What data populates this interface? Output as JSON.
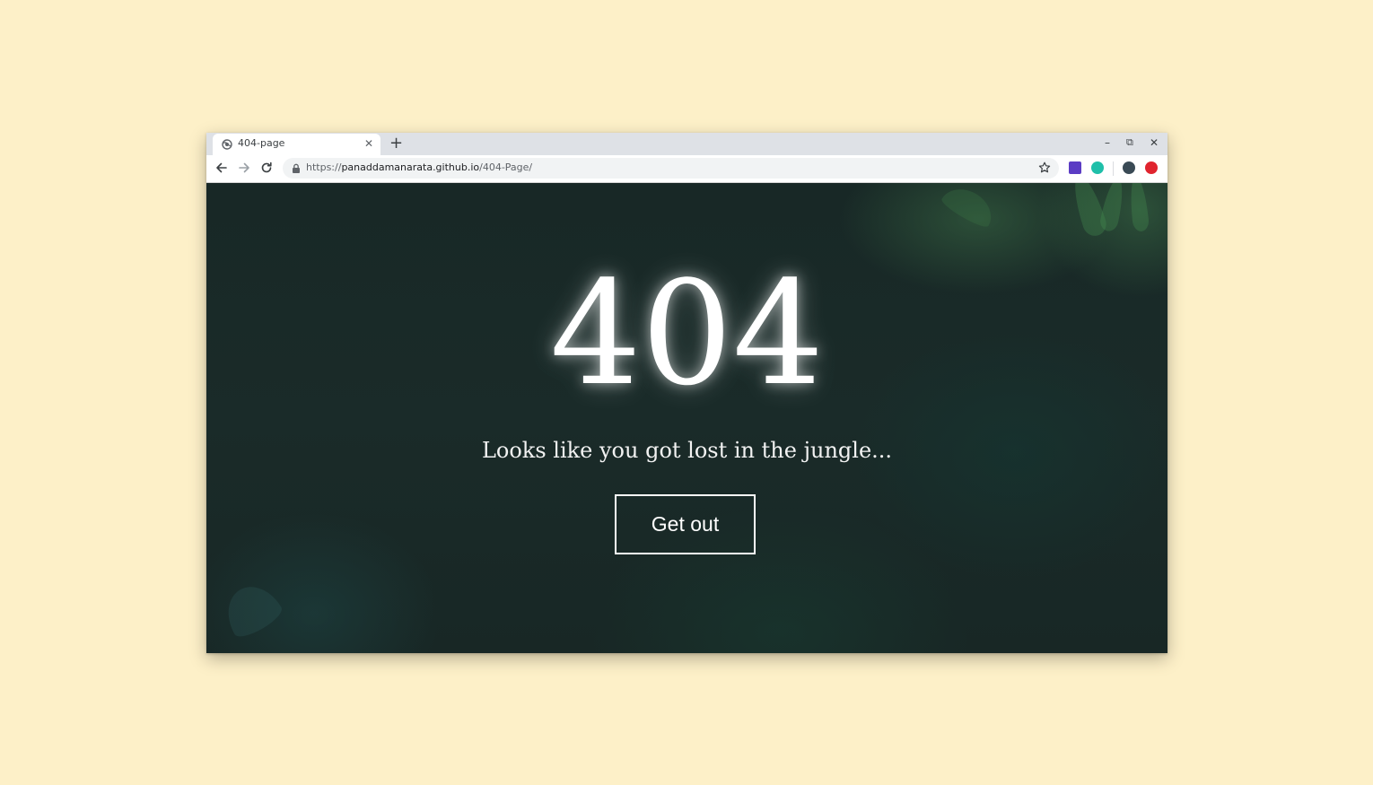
{
  "browser": {
    "tab": {
      "title": "404-page",
      "close_glyph": "✕"
    },
    "new_tab_glyph": "+",
    "window_controls": {
      "minimize": "–",
      "restore": "⧉",
      "close": "✕"
    },
    "address": {
      "scheme": "https://",
      "host": "panaddamanarata.github.io",
      "path": "/404-Page/"
    },
    "extensions": [
      {
        "name": "extension-purple-icon",
        "color": "#5b3cc4"
      },
      {
        "name": "extension-teal-icon",
        "color": "#1fbfa9"
      },
      {
        "name": "profile-avatar",
        "color": "#3a4a55"
      },
      {
        "name": "extension-red-icon",
        "color": "#e0242e"
      }
    ]
  },
  "page": {
    "heading": "404",
    "subtitle": "Looks like you got lost in the jungle...",
    "button_label": "Get out"
  },
  "colors": {
    "desktop_background": "#fdf0c8",
    "page_background": "#1a2a29",
    "text": "#ffffff"
  }
}
